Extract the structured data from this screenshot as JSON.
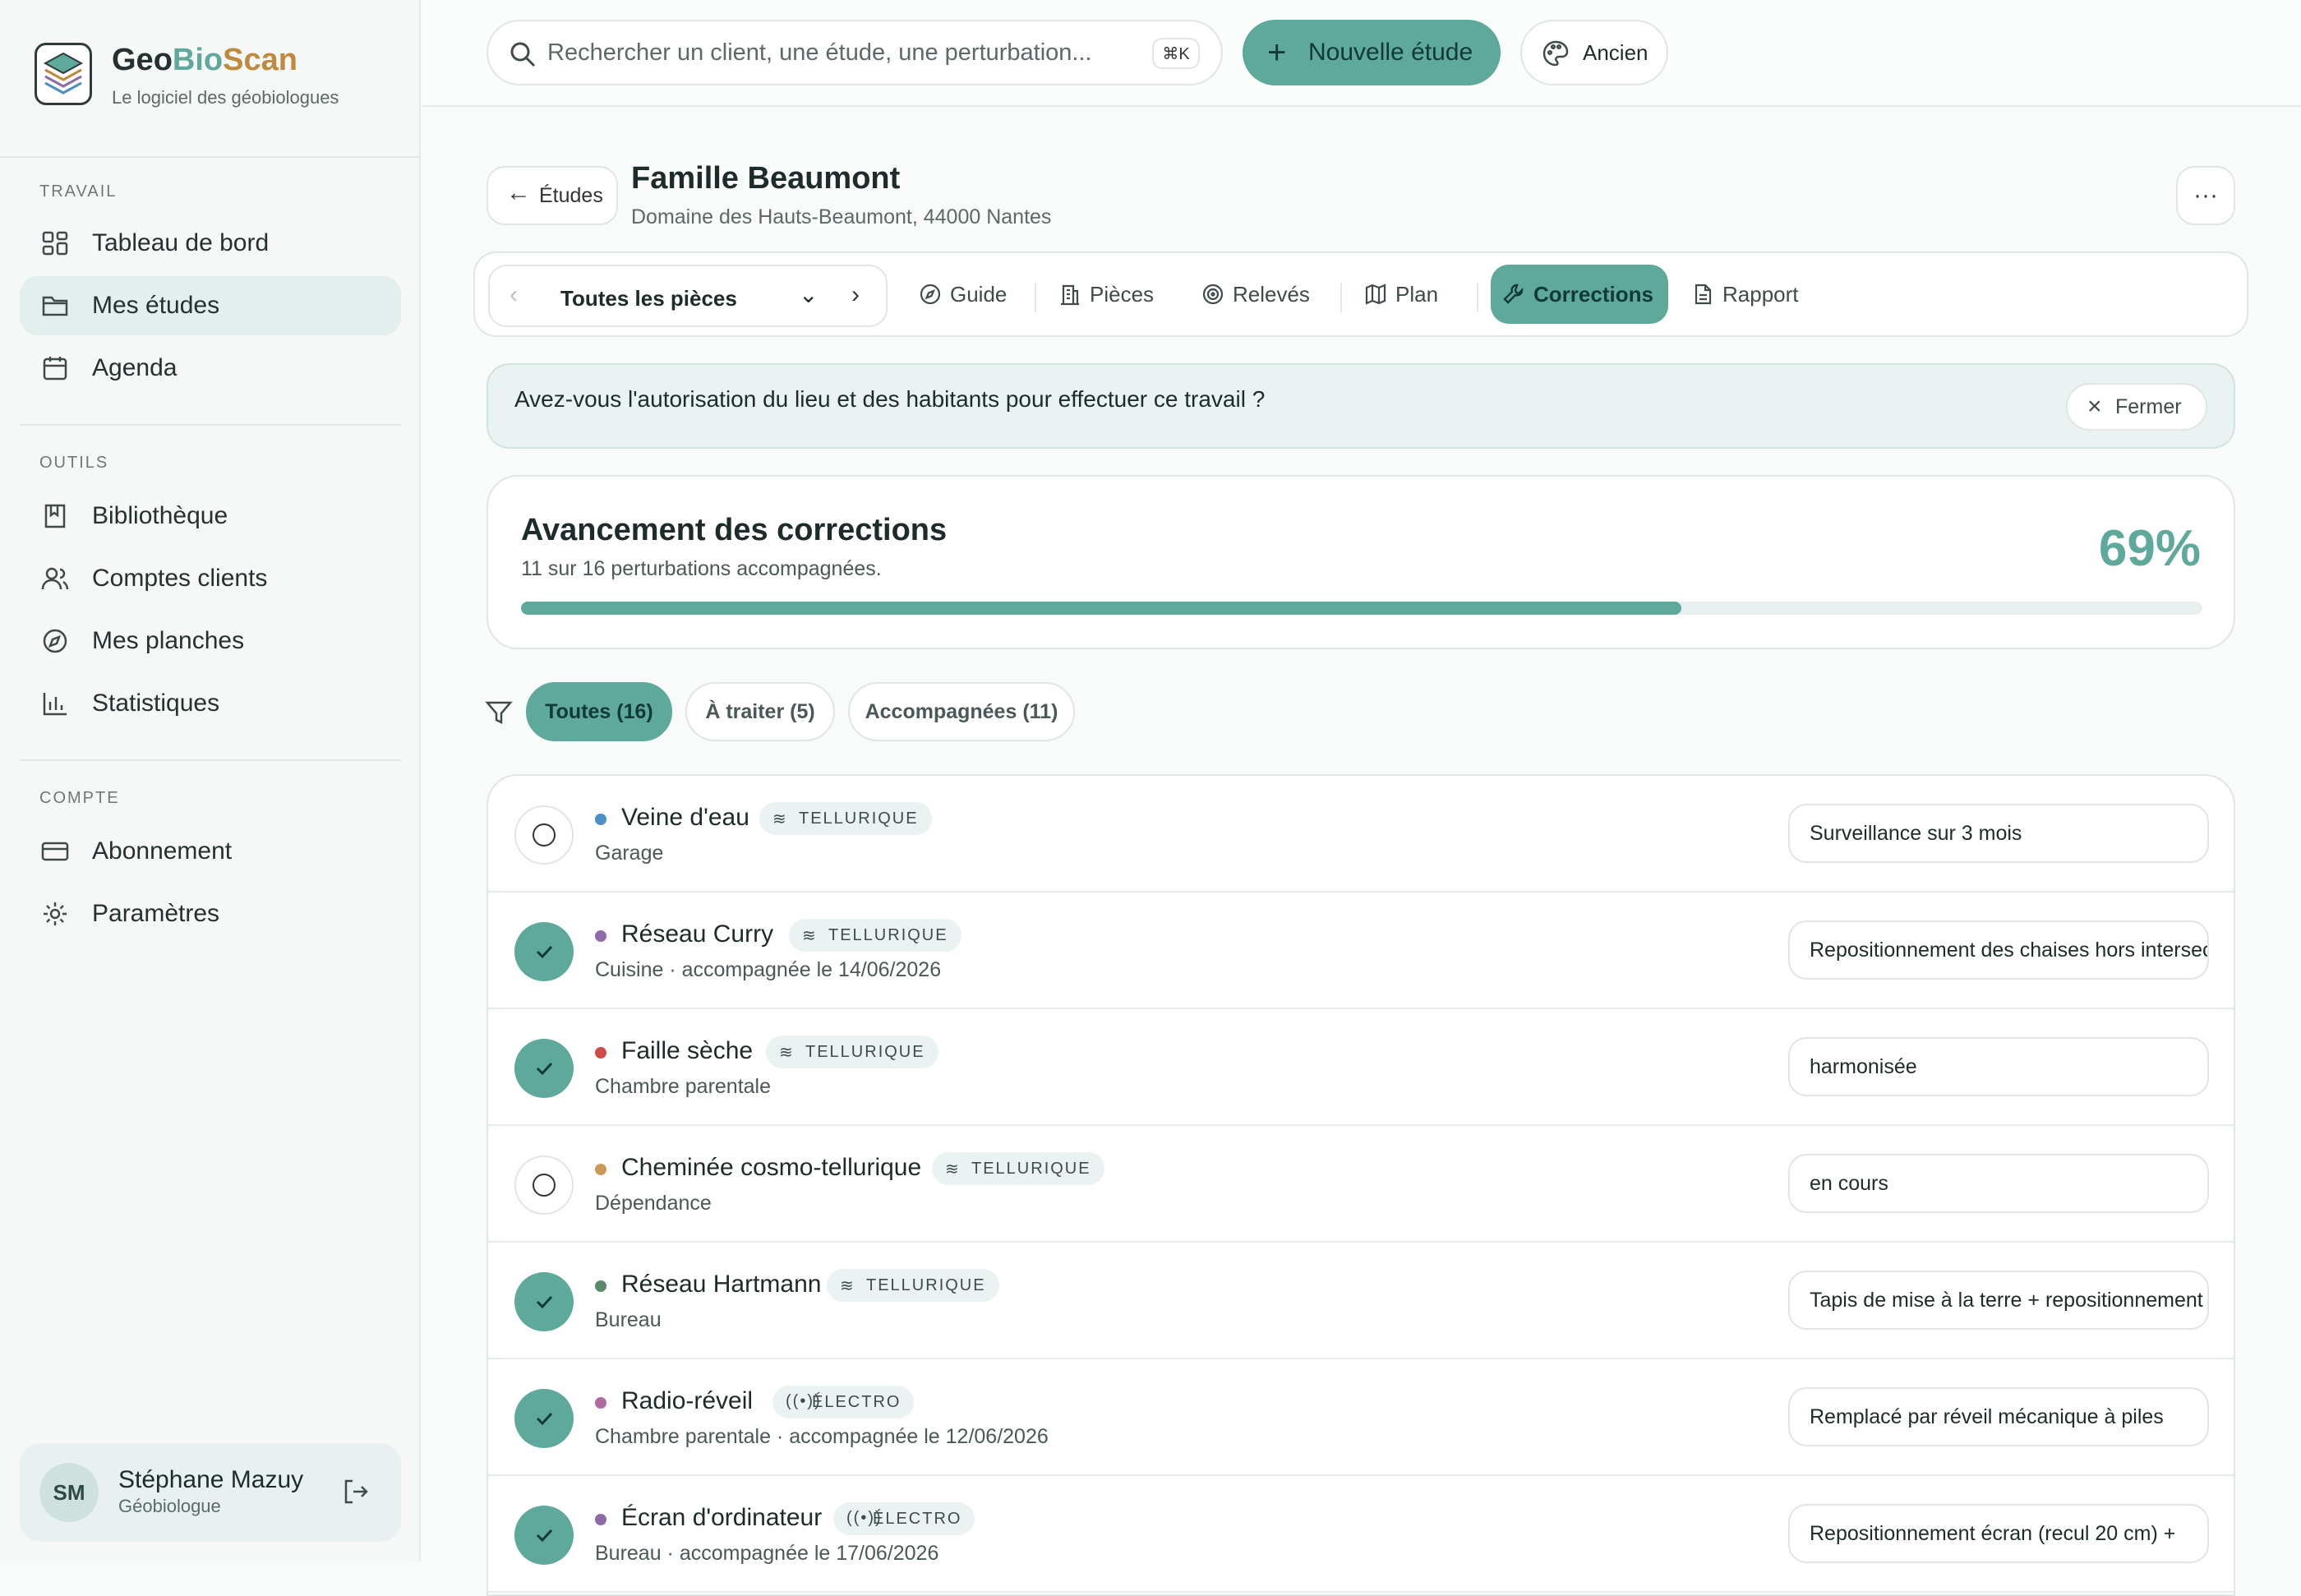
{
  "app": {
    "brand_part1": "Geo",
    "brand_part2": "Bio",
    "brand_part3": "Scan",
    "tagline": "Le logiciel des géobiologues"
  },
  "colors": {
    "accent": "#5fa89c",
    "brand_orange": "#c08a3e"
  },
  "sidebar": {
    "section_travail": "TRAVAIL",
    "section_outils": "OUTILS",
    "section_compte": "COMPTE",
    "items": [
      {
        "label": "Tableau de bord",
        "icon": "dashboard-icon"
      },
      {
        "label": "Mes études",
        "icon": "folder-icon",
        "active": true
      },
      {
        "label": "Agenda",
        "icon": "calendar-icon"
      },
      {
        "label": "Bibliothèque",
        "icon": "book-icon"
      },
      {
        "label": "Comptes clients",
        "icon": "users-icon"
      },
      {
        "label": "Mes planches",
        "icon": "compass-icon"
      },
      {
        "label": "Statistiques",
        "icon": "chart-icon"
      },
      {
        "label": "Abonnement",
        "icon": "credit-card-icon"
      },
      {
        "label": "Paramètres",
        "icon": "gear-icon"
      }
    ],
    "user": {
      "initials": "SM",
      "name": "Stéphane Mazuy",
      "role": "Géobiologue"
    }
  },
  "topbar": {
    "search_placeholder": "Rechercher un client, une étude, une perturbation...",
    "shortcut": "⌘K",
    "new_study": "Nouvelle étude",
    "theme": "Ancien"
  },
  "study": {
    "back": "Études",
    "title": "Famille Beaumont",
    "address": "Domaine des Hauts-Beaumont, 44000 Nantes",
    "more": "···",
    "room_select": "Toutes les pièces",
    "tabs": [
      {
        "label": "Guide",
        "icon": "compass-icon"
      },
      {
        "label": "Pièces",
        "icon": "building-icon"
      },
      {
        "label": "Relevés",
        "icon": "radar-icon"
      },
      {
        "label": "Plan",
        "icon": "map-icon"
      },
      {
        "label": "Corrections",
        "icon": "wrench-icon",
        "active": true
      },
      {
        "label": "Rapport",
        "icon": "document-icon"
      }
    ]
  },
  "notice": {
    "text": "Avez-vous l'autorisation du lieu et des habitants pour effectuer ce travail ?",
    "close": "Fermer"
  },
  "progress": {
    "title": "Avancement des corrections",
    "subtitle": "11 sur 16 perturbations accompagnées.",
    "percent_label": "69%",
    "fraction": 0.69
  },
  "filters": [
    {
      "label": "Toutes (16)",
      "active": true
    },
    {
      "label": "À traiter (5)"
    },
    {
      "label": "Accompagnées (11)"
    }
  ],
  "perturbations": [
    {
      "name": "Veine d'eau",
      "type": "TELLURIQUE",
      "kind": "tellurique",
      "dot": "#4a8fc8",
      "room": "Garage",
      "done": false,
      "note": "Surveillance sur 3 mois"
    },
    {
      "name": "Réseau Curry",
      "type": "TELLURIQUE",
      "kind": "tellurique",
      "dot": "#8e6aa8",
      "room": "Cuisine · accompagnée le 14/06/2026",
      "done": true,
      "note": "Repositionnement des chaises hors intersection"
    },
    {
      "name": "Faille sèche",
      "type": "TELLURIQUE",
      "kind": "tellurique",
      "dot": "#d04a4a",
      "room": "Chambre parentale",
      "done": true,
      "note": "harmonisée"
    },
    {
      "name": "Cheminée cosmo-tellurique",
      "type": "TELLURIQUE",
      "kind": "tellurique",
      "dot": "#c89a5a",
      "room": "Dépendance",
      "done": false,
      "note": "en cours"
    },
    {
      "name": "Réseau Hartmann",
      "type": "TELLURIQUE",
      "kind": "tellurique",
      "dot": "#5a8a6a",
      "room": "Bureau",
      "done": true,
      "note": "Tapis de mise à la terre + repositionnement"
    },
    {
      "name": "Radio-réveil",
      "type": "ÉLECTRO",
      "kind": "electro",
      "dot": "#b06aa0",
      "room": "Chambre parentale · accompagnée le 12/06/2026",
      "done": true,
      "note": "Remplacé par réveil mécanique à piles"
    },
    {
      "name": "Écran d'ordinateur",
      "type": "ÉLECTRO",
      "kind": "electro",
      "dot": "#8e6aa8",
      "room": "Bureau · accompagnée le 17/06/2026",
      "done": true,
      "note": "Repositionnement écran (recul 20 cm) +"
    }
  ]
}
